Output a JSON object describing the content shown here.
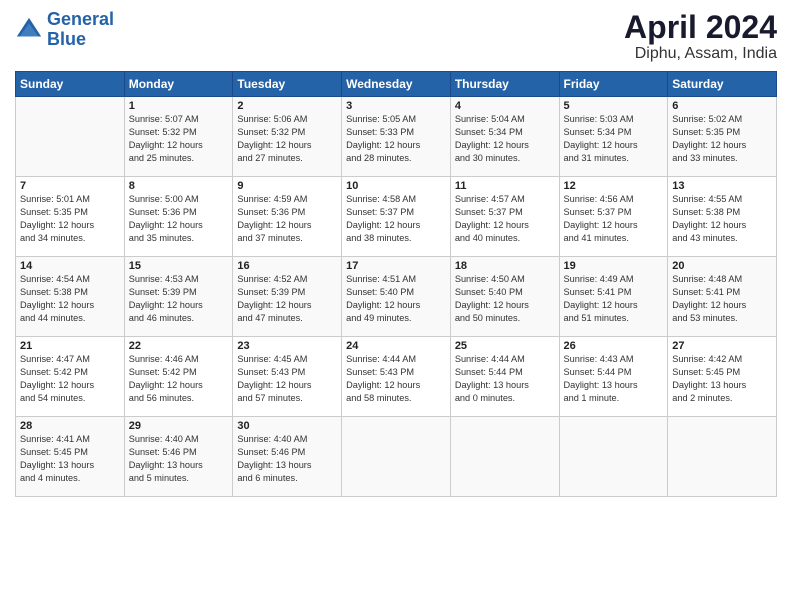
{
  "header": {
    "logo_line1": "General",
    "logo_line2": "Blue",
    "title": "April 2024",
    "subtitle": "Diphu, Assam, India"
  },
  "columns": [
    "Sunday",
    "Monday",
    "Tuesday",
    "Wednesday",
    "Thursday",
    "Friday",
    "Saturday"
  ],
  "weeks": [
    [
      {
        "day": "",
        "info": ""
      },
      {
        "day": "1",
        "info": "Sunrise: 5:07 AM\nSunset: 5:32 PM\nDaylight: 12 hours\nand 25 minutes."
      },
      {
        "day": "2",
        "info": "Sunrise: 5:06 AM\nSunset: 5:32 PM\nDaylight: 12 hours\nand 27 minutes."
      },
      {
        "day": "3",
        "info": "Sunrise: 5:05 AM\nSunset: 5:33 PM\nDaylight: 12 hours\nand 28 minutes."
      },
      {
        "day": "4",
        "info": "Sunrise: 5:04 AM\nSunset: 5:34 PM\nDaylight: 12 hours\nand 30 minutes."
      },
      {
        "day": "5",
        "info": "Sunrise: 5:03 AM\nSunset: 5:34 PM\nDaylight: 12 hours\nand 31 minutes."
      },
      {
        "day": "6",
        "info": "Sunrise: 5:02 AM\nSunset: 5:35 PM\nDaylight: 12 hours\nand 33 minutes."
      }
    ],
    [
      {
        "day": "7",
        "info": "Sunrise: 5:01 AM\nSunset: 5:35 PM\nDaylight: 12 hours\nand 34 minutes."
      },
      {
        "day": "8",
        "info": "Sunrise: 5:00 AM\nSunset: 5:36 PM\nDaylight: 12 hours\nand 35 minutes."
      },
      {
        "day": "9",
        "info": "Sunrise: 4:59 AM\nSunset: 5:36 PM\nDaylight: 12 hours\nand 37 minutes."
      },
      {
        "day": "10",
        "info": "Sunrise: 4:58 AM\nSunset: 5:37 PM\nDaylight: 12 hours\nand 38 minutes."
      },
      {
        "day": "11",
        "info": "Sunrise: 4:57 AM\nSunset: 5:37 PM\nDaylight: 12 hours\nand 40 minutes."
      },
      {
        "day": "12",
        "info": "Sunrise: 4:56 AM\nSunset: 5:37 PM\nDaylight: 12 hours\nand 41 minutes."
      },
      {
        "day": "13",
        "info": "Sunrise: 4:55 AM\nSunset: 5:38 PM\nDaylight: 12 hours\nand 43 minutes."
      }
    ],
    [
      {
        "day": "14",
        "info": "Sunrise: 4:54 AM\nSunset: 5:38 PM\nDaylight: 12 hours\nand 44 minutes."
      },
      {
        "day": "15",
        "info": "Sunrise: 4:53 AM\nSunset: 5:39 PM\nDaylight: 12 hours\nand 46 minutes."
      },
      {
        "day": "16",
        "info": "Sunrise: 4:52 AM\nSunset: 5:39 PM\nDaylight: 12 hours\nand 47 minutes."
      },
      {
        "day": "17",
        "info": "Sunrise: 4:51 AM\nSunset: 5:40 PM\nDaylight: 12 hours\nand 49 minutes."
      },
      {
        "day": "18",
        "info": "Sunrise: 4:50 AM\nSunset: 5:40 PM\nDaylight: 12 hours\nand 50 minutes."
      },
      {
        "day": "19",
        "info": "Sunrise: 4:49 AM\nSunset: 5:41 PM\nDaylight: 12 hours\nand 51 minutes."
      },
      {
        "day": "20",
        "info": "Sunrise: 4:48 AM\nSunset: 5:41 PM\nDaylight: 12 hours\nand 53 minutes."
      }
    ],
    [
      {
        "day": "21",
        "info": "Sunrise: 4:47 AM\nSunset: 5:42 PM\nDaylight: 12 hours\nand 54 minutes."
      },
      {
        "day": "22",
        "info": "Sunrise: 4:46 AM\nSunset: 5:42 PM\nDaylight: 12 hours\nand 56 minutes."
      },
      {
        "day": "23",
        "info": "Sunrise: 4:45 AM\nSunset: 5:43 PM\nDaylight: 12 hours\nand 57 minutes."
      },
      {
        "day": "24",
        "info": "Sunrise: 4:44 AM\nSunset: 5:43 PM\nDaylight: 12 hours\nand 58 minutes."
      },
      {
        "day": "25",
        "info": "Sunrise: 4:44 AM\nSunset: 5:44 PM\nDaylight: 13 hours\nand 0 minutes."
      },
      {
        "day": "26",
        "info": "Sunrise: 4:43 AM\nSunset: 5:44 PM\nDaylight: 13 hours\nand 1 minute."
      },
      {
        "day": "27",
        "info": "Sunrise: 4:42 AM\nSunset: 5:45 PM\nDaylight: 13 hours\nand 2 minutes."
      }
    ],
    [
      {
        "day": "28",
        "info": "Sunrise: 4:41 AM\nSunset: 5:45 PM\nDaylight: 13 hours\nand 4 minutes."
      },
      {
        "day": "29",
        "info": "Sunrise: 4:40 AM\nSunset: 5:46 PM\nDaylight: 13 hours\nand 5 minutes."
      },
      {
        "day": "30",
        "info": "Sunrise: 4:40 AM\nSunset: 5:46 PM\nDaylight: 13 hours\nand 6 minutes."
      },
      {
        "day": "",
        "info": ""
      },
      {
        "day": "",
        "info": ""
      },
      {
        "day": "",
        "info": ""
      },
      {
        "day": "",
        "info": ""
      }
    ]
  ]
}
